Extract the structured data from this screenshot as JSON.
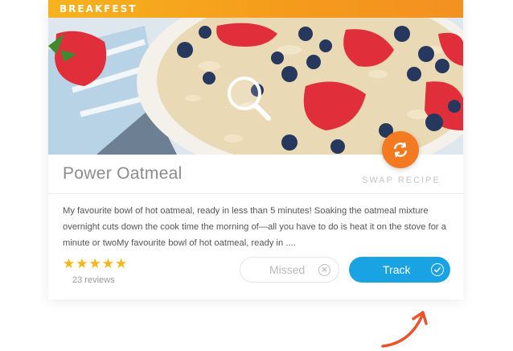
{
  "card": {
    "category": "BREAKFEST",
    "title": "Power Oatmeal",
    "swap_label": "SWAP RECIPE",
    "description": "My favourite bowl of hot oatmeal, ready in less than 5 minutes! Soaking the oatmeal mixture overnight cuts down the cook time the morning of—all you have to do is heat it on the stove for a minute or twoMy favourite bowl of hot oatmeal, ready in ....",
    "rating_stars": "★★★★★",
    "rating": 5,
    "reviews": "23 reviews",
    "missed_label": "Missed",
    "track_label": "Track"
  },
  "colors": {
    "banner": "#f59a1c",
    "swap": "#f47a22",
    "track": "#1aa3e3",
    "stars": "#f5b717",
    "arrow": "#e8542e"
  },
  "icons": {
    "swap": "refresh-icon",
    "magnifier": "magnifier-icon",
    "missed": "close-circle-icon",
    "track": "check-circle-icon",
    "arrow": "curved-arrow-icon"
  }
}
